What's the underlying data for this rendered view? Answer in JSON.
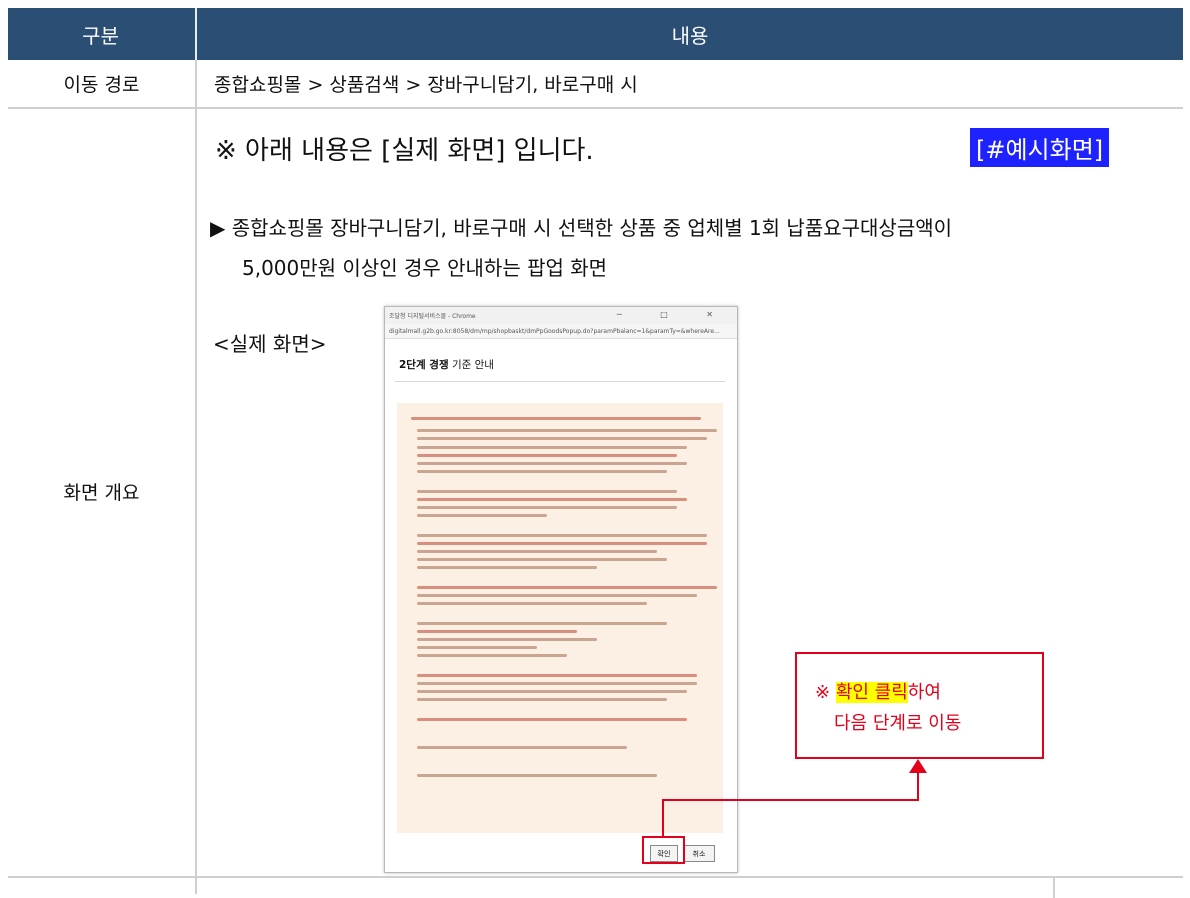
{
  "table": {
    "header": {
      "col1": "구분",
      "col2": "내용"
    },
    "row1": {
      "label": "이동 경로",
      "value": "종합쇼핑몰 > 상품검색 > 장바구니담기, 바로구매 시"
    },
    "row2": {
      "label": "화면 개요",
      "note": "※ 아래 내용은 [실제 화면] 입니다.",
      "tag": "[#예시화면]",
      "desc_line1": "▶ 종합쇼핑몰 장바구니담기, 바로구매 시 선택한 상품 중 업체별 1회 납품요구대상금액이",
      "desc_line2": "5,000만원 이상인 경우 안내하는 팝업 화면",
      "screen_label": "<실제 화면>"
    }
  },
  "popup": {
    "window_title": "조달청 디지털서비스몰 - Chrome",
    "window_controls": "─ □ ✕",
    "url": "digitalmall.g2b.go.kr:8058/dm/mp/shopbaskt/dmPpGoodsPopup.do?paramPbalanc=1&paramTy=&whereAre...",
    "title_bold": "2단계 경쟁",
    "title_rest": "기준 안내",
    "confirm_button": "확인",
    "cancel_button": "취소"
  },
  "callout": {
    "prefix": "※ ",
    "highlight": "확인 클릭",
    "suffix": "하여",
    "line2": "다음 단계로 이동"
  },
  "colors": {
    "header_bg": "#2b4f74",
    "tag_bg": "#1e22ff",
    "callout_red": "#e3001b",
    "highlight_yellow": "#ffff00",
    "popup_content_bg": "#fcefe3"
  }
}
